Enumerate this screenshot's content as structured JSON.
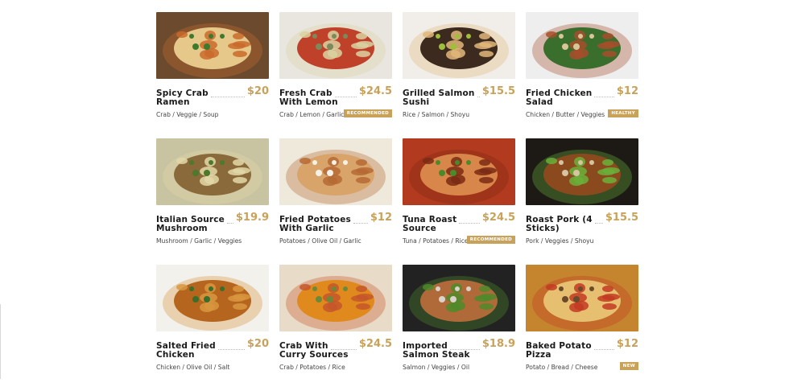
{
  "menu": [
    {
      "name": "Spicy Crab Ramen",
      "price": "$20",
      "ingredients": "Crab / Veggie / Soup",
      "badge": "",
      "image": "crab-ramen-photo",
      "colors": [
        "#6b4a2e",
        "#e6c98a",
        "#c96a2c",
        "#3e7a2e"
      ]
    },
    {
      "name": "Fresh Crab With Lemon",
      "price": "$24.5",
      "ingredients": "Crab / Lemon / Garlic",
      "badge": "RECOMMENDED",
      "image": "crab-lemon-photo",
      "colors": [
        "#e9e6e0",
        "#c0412a",
        "#d9d2a0",
        "#7a8a5a"
      ]
    },
    {
      "name": "Grilled Salmon Sushi",
      "price": "$15.5",
      "ingredients": "Rice / Salmon / Shoyu",
      "badge": "",
      "image": "salmon-sushi-photo",
      "colors": [
        "#f1eeea",
        "#3b2a1d",
        "#e2b67a",
        "#9fbf3a"
      ]
    },
    {
      "name": "Fried Chicken Salad",
      "price": "$12",
      "ingredients": "Chicken / Butter / Veggies",
      "badge": "HEALTHY",
      "image": "chicken-salad-photo",
      "colors": [
        "#eeeeee",
        "#3a6e2c",
        "#a74d2a",
        "#d9c59a"
      ]
    },
    {
      "name": "Italian Source Mushroom",
      "price": "$19.9",
      "ingredients": "Mushroom / Garlic / Veggies",
      "badge": "",
      "image": "mushroom-photo",
      "colors": [
        "#c8c3a0",
        "#8a6a3a",
        "#e3d7a8",
        "#4a7a2a"
      ]
    },
    {
      "name": "Fried Potatoes With Garlic",
      "price": "$12",
      "ingredients": "Potatoes / Olive Oil / Garlic",
      "badge": "",
      "image": "potatoes-photo",
      "colors": [
        "#efe9dc",
        "#d9a46a",
        "#b56a34",
        "#f6f1e6"
      ]
    },
    {
      "name": "Tuna Roast Source",
      "price": "$24.5",
      "ingredients": "Tuna / Potatoes / Rice",
      "badge": "RECOMMENDED",
      "image": "tuna-roast-photo",
      "colors": [
        "#b23a1e",
        "#d9864a",
        "#7a2a14",
        "#4a8a2a"
      ]
    },
    {
      "name": "Roast Pork (4 Sticks)",
      "price": "$15.5",
      "ingredients": "Pork / Veggies / Shoyu",
      "badge": "",
      "image": "roast-pork-photo",
      "colors": [
        "#1d1a16",
        "#8a4a1e",
        "#6ab03a",
        "#d6c3a0"
      ]
    },
    {
      "name": "Salted Fried Chicken",
      "price": "$20",
      "ingredients": "Chicken / Olive Oil / Salt",
      "badge": "",
      "image": "fried-chicken-photo",
      "colors": [
        "#f3f1ec",
        "#b5651d",
        "#d89640",
        "#3a6e2a"
      ]
    },
    {
      "name": "Crab With Curry Sources",
      "price": "$24.5",
      "ingredients": "Crab / Potatoes / Rice",
      "badge": "",
      "image": "crab-curry-photo",
      "colors": [
        "#e8dcc8",
        "#e08a1e",
        "#c5562a",
        "#6a8a3a"
      ]
    },
    {
      "name": "Imported Salmon Steak",
      "price": "$18.9",
      "ingredients": "Salmon / Veggies / Oil",
      "badge": "",
      "image": "salmon-steak-photo",
      "colors": [
        "#222222",
        "#b06a3a",
        "#4e8a2a",
        "#d9d3c8"
      ]
    },
    {
      "name": "Baked Potato Pizza",
      "price": "$12",
      "ingredients": "Potato / Bread / Cheese",
      "badge": "NEW",
      "image": "potato-pizza-photo",
      "colors": [
        "#c5852e",
        "#e6c070",
        "#c23a22",
        "#6a4a2a"
      ]
    }
  ]
}
